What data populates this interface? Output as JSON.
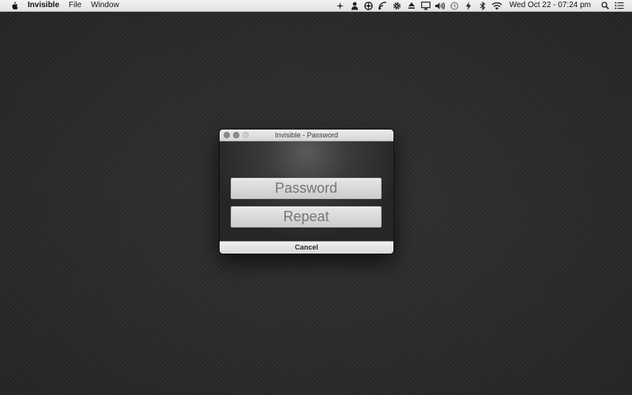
{
  "menubar": {
    "app_name": "Invisible",
    "menus": [
      "File",
      "Window"
    ],
    "clock": "Wed Oct 22 - 07:24 pm",
    "status_icons": [
      "sparkle-icon",
      "user-icon",
      "aperture-icon",
      "sync-icon",
      "gear-icon",
      "eject-icon",
      "airplay-icon",
      "volume-icon",
      "time-machine-icon",
      "lightning-icon",
      "bluetooth-icon",
      "wifi-icon"
    ]
  },
  "window": {
    "title": "Invisible - Password",
    "password_placeholder": "Password",
    "repeat_placeholder": "Repeat",
    "cancel_label": "Cancel"
  }
}
